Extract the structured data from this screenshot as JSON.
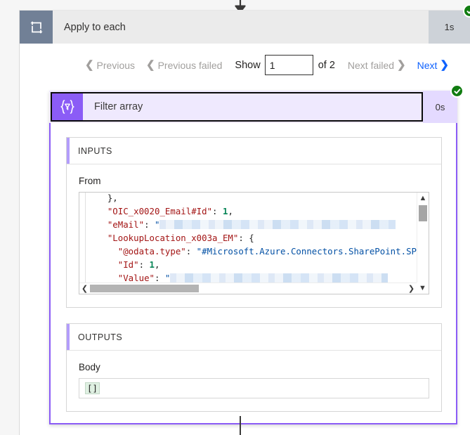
{
  "loop_action": {
    "icon": "loop-repeat-icon",
    "title": "Apply to each",
    "duration": "1s",
    "status": "succeeded",
    "status_icon": "check-circle-icon"
  },
  "pager": {
    "previous_label": "Previous",
    "previous_failed_label": "Previous failed",
    "show_label": "Show",
    "current_index": "1",
    "of_label": "of 2",
    "next_failed_label": "Next failed",
    "next_label": "Next",
    "prev_chevron_icon": "chevron-left-icon",
    "next_chevron_icon": "chevron-right-icon"
  },
  "filter_action": {
    "icon": "filter-array-icon",
    "title": "Filter array",
    "duration": "0s",
    "status": "succeeded",
    "status_icon": "check-circle-icon"
  },
  "inputs": {
    "section_title": "INPUTS",
    "field_label": "From",
    "code_lines": [
      {
        "segments": [
          {
            "t": "    },",
            "c": "p"
          }
        ]
      },
      {
        "segments": [
          {
            "t": "    ",
            "c": "p"
          },
          {
            "t": "\"OIC_x0020_Email#Id\"",
            "c": "k"
          },
          {
            "t": ": ",
            "c": "p"
          },
          {
            "t": "1",
            "c": "n"
          },
          {
            "t": ",",
            "c": "p"
          }
        ]
      },
      {
        "segments": [
          {
            "t": "    ",
            "c": "p"
          },
          {
            "t": "\"eMail\"",
            "c": "k"
          },
          {
            "t": ": ",
            "c": "p"
          },
          {
            "t": "\"",
            "c": "s"
          },
          {
            "t": "REDACT:336",
            "c": "redact"
          }
        ]
      },
      {
        "segments": [
          {
            "t": "    ",
            "c": "p"
          },
          {
            "t": "\"LookupLocation_x003a_EM\"",
            "c": "k"
          },
          {
            "t": ": {",
            "c": "p"
          }
        ]
      },
      {
        "segments": [
          {
            "t": "      ",
            "c": "p"
          },
          {
            "t": "\"@odata.type\"",
            "c": "k"
          },
          {
            "t": ": ",
            "c": "p"
          },
          {
            "t": "\"#Microsoft.Azure.Connectors.SharePoint.SPList",
            "c": "s"
          }
        ]
      },
      {
        "segments": [
          {
            "t": "      ",
            "c": "p"
          },
          {
            "t": "\"Id\"",
            "c": "k"
          },
          {
            "t": ": ",
            "c": "p"
          },
          {
            "t": "1",
            "c": "n"
          },
          {
            "t": ",",
            "c": "p"
          }
        ]
      },
      {
        "segments": [
          {
            "t": "      ",
            "c": "p"
          },
          {
            "t": "\"Value\"",
            "c": "k"
          },
          {
            "t": ": ",
            "c": "p"
          },
          {
            "t": "\"",
            "c": "s"
          },
          {
            "t": "REDACT:310",
            "c": "redact"
          }
        ]
      },
      {
        "segments": [
          {
            "t": "    }",
            "c": "p"
          }
        ]
      }
    ],
    "scroll": {
      "up_arrow_icon": "chevron-up-icon",
      "down_arrow_icon": "chevron-down-icon",
      "left_arrow_icon": "chevron-left-icon",
      "right_arrow_icon": "chevron-right-icon"
    }
  },
  "outputs": {
    "section_title": "OUTPUTS",
    "field_label": "Body",
    "value": "[]"
  },
  "colors": {
    "accent_purple": "#8b5cf6",
    "header_gray": "#ebebeb",
    "loop_icon_bg": "#718096",
    "success_green": "#107c10",
    "link_blue": "#0f62fe",
    "disabled_gray": "#a19f9d"
  }
}
